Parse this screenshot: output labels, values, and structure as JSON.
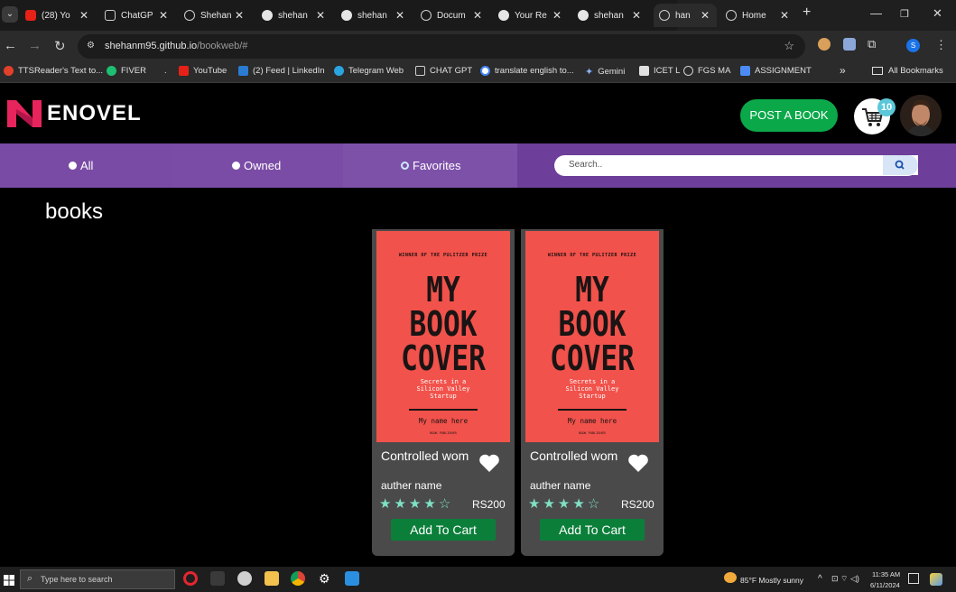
{
  "browser": {
    "tabs": [
      {
        "label": "(28) Yo",
        "icon": "youtube-icon",
        "color": "#e62117"
      },
      {
        "label": "ChatGP",
        "icon": "chatgpt-icon",
        "color": "#cfcfcf"
      },
      {
        "label": "Shehan",
        "icon": "globe-icon",
        "color": "#cfcfcf"
      },
      {
        "label": "shehan",
        "icon": "github-icon",
        "color": "#cfcfcf"
      },
      {
        "label": "shehan",
        "icon": "github-icon",
        "color": "#cfcfcf"
      },
      {
        "label": "Docum",
        "icon": "globe-icon",
        "color": "#cfcfcf"
      },
      {
        "label": "Your Re",
        "icon": "github-icon",
        "color": "#cfcfcf"
      },
      {
        "label": "shehan",
        "icon": "github-icon",
        "color": "#cfcfcf"
      },
      {
        "label": "han",
        "icon": "globe-icon",
        "color": "#cfcfcf"
      },
      {
        "label": "Home",
        "icon": "globe-icon",
        "color": "#cfcfcf"
      }
    ],
    "url_host": "shehanm95.github.io",
    "url_path": "/bookweb/#",
    "profile_initial": "S",
    "bookmarks": [
      {
        "label": "TTSReader's Text to...",
        "color": "#e3402b"
      },
      {
        "label": "FIVER",
        "color": "#1dbf73"
      },
      {
        "label": ".",
        "color": ""
      },
      {
        "label": "YouTube",
        "color": "#e62117"
      },
      {
        "label": "(2) Feed | LinkedIn",
        "color": "#2a7bd2"
      },
      {
        "label": "Telegram Web",
        "color": "#2aa5e0"
      },
      {
        "label": "CHAT GPT",
        "color": "#cfcfcf"
      },
      {
        "label": "translate english to...",
        "color": "#4285f4"
      },
      {
        "label": "Gemini",
        "color": "#8ab4f8"
      },
      {
        "label": "ICET L",
        "color": "#e0e0e0"
      },
      {
        "label": "FGS MA",
        "color": "#cfcfcf"
      },
      {
        "label": "ASSIGNMENT",
        "color": "#4c8bf5"
      }
    ],
    "bookmarks_more": "»",
    "all_bookmarks": "All Bookmarks"
  },
  "site": {
    "logo_text": "ENOVEL",
    "post_button": "POST A BOOK",
    "cart_count": "10",
    "filters": [
      {
        "label": "All",
        "style": "filled"
      },
      {
        "label": "Owned",
        "style": "filled"
      },
      {
        "label": "Favorites",
        "style": "hollow"
      }
    ],
    "search_placeholder": "Search..",
    "section_title": "books",
    "books": [
      {
        "cover_prize": "WINNER OF THE PULITZER PRIZE",
        "cover_line1": "MY",
        "cover_line2": "BOOK",
        "cover_line3": "COVER",
        "cover_subtitle": "Secrets in a Silicon Valley Startup",
        "cover_name": "My name here",
        "cover_publisher": "BOOK PUBLISHER",
        "title": "Controlled wom",
        "author": "auther name",
        "rating": 4,
        "rating_max": 5,
        "price": "RS200",
        "add_label": "Add To Cart"
      },
      {
        "cover_prize": "WINNER OF THE PULITZER PRIZE",
        "cover_line1": "MY",
        "cover_line2": "BOOK",
        "cover_line3": "COVER",
        "cover_subtitle": "Secrets in a Silicon Valley Startup",
        "cover_name": "My name here",
        "cover_publisher": "BOOK PUBLISHER",
        "title": "Controlled wom",
        "author": "auther name",
        "rating": 4,
        "rating_max": 5,
        "price": "RS200",
        "add_label": "Add To Cart"
      }
    ]
  },
  "taskbar": {
    "search_placeholder": "Type here to search",
    "weather": "85°F  Mostly sunny",
    "time": "11:35 AM",
    "date": "6/11/2024"
  },
  "colors": {
    "accent_purple": "#7a4ba5",
    "post_green": "#0ba84a",
    "cart_green": "#0b7f3a",
    "cover_red": "#f1524b",
    "badge_cyan": "#5cc7d9",
    "star_mint": "#7fe0c4"
  }
}
